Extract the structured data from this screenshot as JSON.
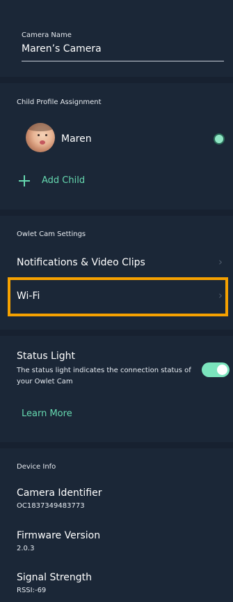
{
  "camera_name": {
    "label": "Camera Name",
    "value": "Maren’s Camera"
  },
  "child_profile": {
    "section_title": "Child Profile Assignment",
    "children": [
      {
        "name": "Maren",
        "selected": true
      }
    ],
    "add_child_label": "Add Child",
    "accent_color": "#66d9b0"
  },
  "settings": {
    "section_title": "Owlet Cam Settings",
    "rows": [
      {
        "label": "Notifications & Video Clips",
        "icon": "chevron-right-icon"
      },
      {
        "label": "Wi-Fi",
        "icon": "chevron-right-icon",
        "highlighted": true
      }
    ],
    "highlight_color": "#f5a100"
  },
  "status_light": {
    "title": "Status Light",
    "description": "The status light indicates the connection status of your Owlet Cam",
    "enabled": true,
    "learn_more_label": "Learn More"
  },
  "device_info": {
    "section_title": "Device Info",
    "items": [
      {
        "label": "Camera Identifier",
        "value": "OC1837349483773"
      },
      {
        "label": "Firmware Version",
        "value": "2.0.3"
      },
      {
        "label": "Signal Strength",
        "value": "RSSI:-69"
      }
    ]
  },
  "colors": {
    "background": "#1b2737",
    "separator": "#172130",
    "toggle_on": "#7be4bd"
  }
}
